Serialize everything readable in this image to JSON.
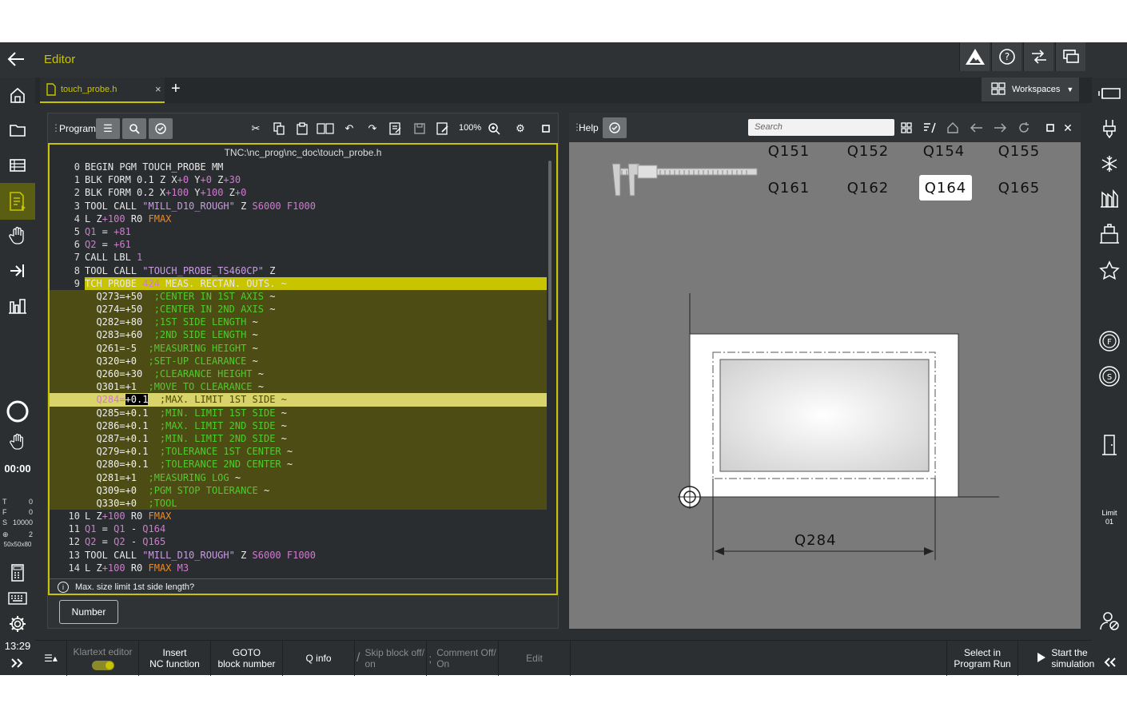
{
  "header": {
    "title": "Editor"
  },
  "tabs": {
    "file_name": "touch_probe.h",
    "close": "×",
    "add": "+",
    "workspaces_label": "Workspaces"
  },
  "sidebar": {
    "clock": "00:00",
    "time": "13:29",
    "status": [
      {
        "label": "T",
        "value": "0"
      },
      {
        "label": "F",
        "value": "0"
      },
      {
        "label": "S",
        "value": "10000"
      },
      {
        "label": "⊕",
        "value": "2"
      }
    ],
    "blank_size": "50x50x80"
  },
  "right_sidebar": {
    "limit_label": "Limit",
    "limit_value": "01"
  },
  "program": {
    "label": "Program",
    "zoom": "100%",
    "path": "TNC:\\nc_prog\\nc_doc\\touch_probe.h",
    "question": "Max. size limit 1st side length?",
    "number_button": "Number",
    "lines": [
      {
        "n": "0",
        "parts": [
          [
            "kw",
            "BEGIN PGM TOUCH_PROBE MM"
          ]
        ]
      },
      {
        "n": "1",
        "parts": [
          [
            "kw",
            "BLK FORM 0.1 Z X"
          ],
          [
            "num",
            "+0"
          ],
          [
            "kw",
            " Y"
          ],
          [
            "num",
            "+0"
          ],
          [
            "kw",
            " Z"
          ],
          [
            "num",
            "+30"
          ]
        ]
      },
      {
        "n": "2",
        "parts": [
          [
            "kw",
            "BLK FORM 0.2 X"
          ],
          [
            "num",
            "+100"
          ],
          [
            "kw",
            " Y"
          ],
          [
            "num",
            "+100"
          ],
          [
            "kw",
            " Z"
          ],
          [
            "num",
            "+0"
          ]
        ]
      },
      {
        "n": "3",
        "parts": [
          [
            "kw",
            "TOOL CALL "
          ],
          [
            "str",
            "\"MILL_D10_ROUGH\""
          ],
          [
            "kw",
            " Z "
          ],
          [
            "num",
            "S6000 F1000"
          ]
        ]
      },
      {
        "n": "4",
        "parts": [
          [
            "kw",
            "L Z"
          ],
          [
            "num",
            "+100"
          ],
          [
            "kw",
            " R0 "
          ],
          [
            "orange",
            "FMAX"
          ]
        ]
      },
      {
        "n": "5",
        "parts": [
          [
            "q",
            "Q1"
          ],
          [
            "kw",
            " = "
          ],
          [
            "num",
            "+81"
          ]
        ]
      },
      {
        "n": "6",
        "parts": [
          [
            "q",
            "Q2"
          ],
          [
            "kw",
            " = "
          ],
          [
            "num",
            "+61"
          ]
        ]
      },
      {
        "n": "7",
        "parts": [
          [
            "kw",
            "CALL LBL "
          ],
          [
            "num",
            "1"
          ]
        ]
      },
      {
        "n": "8",
        "parts": [
          [
            "kw",
            "TOOL CALL "
          ],
          [
            "str",
            "\"TOUCH_PROBE_TS460CP\""
          ],
          [
            "kw",
            " Z"
          ]
        ]
      },
      {
        "n": "9",
        "cls": "tch",
        "parts": [
          [
            "kw",
            "TCH PROBE "
          ],
          [
            "num",
            "424"
          ],
          [
            "kw",
            " MEAS. RECTAN. OUTS. ~"
          ]
        ]
      },
      {
        "n": "",
        "cls": "sub",
        "parts": [
          [
            "param",
            "  Q273=+50"
          ],
          [
            "comment",
            "  ;CENTER IN 1ST AXIS"
          ],
          [
            "param",
            " ~"
          ]
        ]
      },
      {
        "n": "",
        "cls": "sub",
        "parts": [
          [
            "param",
            "  Q274=+50"
          ],
          [
            "comment",
            "  ;CENTER IN 2ND AXIS"
          ],
          [
            "param",
            " ~"
          ]
        ]
      },
      {
        "n": "",
        "cls": "sub",
        "parts": [
          [
            "param",
            "  Q282=+80"
          ],
          [
            "comment",
            "  ;1ST SIDE LENGTH"
          ],
          [
            "param",
            " ~"
          ]
        ]
      },
      {
        "n": "",
        "cls": "sub",
        "parts": [
          [
            "param",
            "  Q283=+60"
          ],
          [
            "comment",
            "  ;2ND SIDE LENGTH"
          ],
          [
            "param",
            " ~"
          ]
        ]
      },
      {
        "n": "",
        "cls": "sub",
        "parts": [
          [
            "param",
            "  Q261=-5"
          ],
          [
            "comment",
            "  ;MEASURING HEIGHT"
          ],
          [
            "param",
            " ~"
          ]
        ]
      },
      {
        "n": "",
        "cls": "sub",
        "parts": [
          [
            "param",
            "  Q320=+0"
          ],
          [
            "comment",
            "  ;SET-UP CLEARANCE"
          ],
          [
            "param",
            " ~"
          ]
        ]
      },
      {
        "n": "",
        "cls": "sub",
        "parts": [
          [
            "param",
            "  Q260=+30"
          ],
          [
            "comment",
            "  ;CLEARANCE HEIGHT"
          ],
          [
            "param",
            " ~"
          ]
        ]
      },
      {
        "n": "",
        "cls": "sub",
        "parts": [
          [
            "param",
            "  Q301=+1"
          ],
          [
            "comment",
            "  ;MOVE TO CLEARANCE"
          ],
          [
            "param",
            " ~"
          ]
        ]
      },
      {
        "n": "",
        "cls": "cur",
        "parts": [
          [
            "curq",
            "  Q284="
          ],
          [
            "curval",
            "+0.1"
          ],
          [
            "comment",
            "  ;MAX. LIMIT 1ST SIDE"
          ],
          [
            "param",
            " ~"
          ]
        ]
      },
      {
        "n": "",
        "cls": "sub",
        "parts": [
          [
            "param",
            "  Q285=+0.1"
          ],
          [
            "comment",
            "  ;MIN. LIMIT 1ST SIDE"
          ],
          [
            "param",
            " ~"
          ]
        ]
      },
      {
        "n": "",
        "cls": "sub",
        "parts": [
          [
            "param",
            "  Q286=+0.1"
          ],
          [
            "comment",
            "  ;MAX. LIMIT 2ND SIDE"
          ],
          [
            "param",
            " ~"
          ]
        ]
      },
      {
        "n": "",
        "cls": "sub",
        "parts": [
          [
            "param",
            "  Q287=+0.1"
          ],
          [
            "comment",
            "  ;MIN. LIMIT 2ND SIDE"
          ],
          [
            "param",
            " ~"
          ]
        ]
      },
      {
        "n": "",
        "cls": "sub",
        "parts": [
          [
            "param",
            "  Q279=+0.1"
          ],
          [
            "comment",
            "  ;TOLERANCE 1ST CENTER"
          ],
          [
            "param",
            " ~"
          ]
        ]
      },
      {
        "n": "",
        "cls": "sub",
        "parts": [
          [
            "param",
            "  Q280=+0.1"
          ],
          [
            "comment",
            "  ;TOLERANCE 2ND CENTER"
          ],
          [
            "param",
            " ~"
          ]
        ]
      },
      {
        "n": "",
        "cls": "sub",
        "parts": [
          [
            "param",
            "  Q281=+1"
          ],
          [
            "comment",
            "  ;MEASURING LOG"
          ],
          [
            "param",
            " ~"
          ]
        ]
      },
      {
        "n": "",
        "cls": "sub",
        "parts": [
          [
            "param",
            "  Q309=+0"
          ],
          [
            "comment",
            "  ;PGM STOP TOLERANCE"
          ],
          [
            "param",
            " ~"
          ]
        ]
      },
      {
        "n": "",
        "cls": "sub",
        "parts": [
          [
            "param",
            "  Q330=+0"
          ],
          [
            "comment",
            "  ;TOOL"
          ]
        ]
      },
      {
        "n": "10",
        "parts": [
          [
            "kw",
            "L Z"
          ],
          [
            "num",
            "+100"
          ],
          [
            "kw",
            " R0 "
          ],
          [
            "orange",
            "FMAX"
          ]
        ]
      },
      {
        "n": "11",
        "parts": [
          [
            "q",
            "Q1"
          ],
          [
            "kw",
            " = "
          ],
          [
            "q",
            "Q1"
          ],
          [
            "kw",
            " - "
          ],
          [
            "q",
            "Q164"
          ]
        ]
      },
      {
        "n": "12",
        "parts": [
          [
            "q",
            "Q2"
          ],
          [
            "kw",
            " = "
          ],
          [
            "q",
            "Q2"
          ],
          [
            "kw",
            " - "
          ],
          [
            "q",
            "Q165"
          ]
        ]
      },
      {
        "n": "13",
        "parts": [
          [
            "kw",
            "TOOL CALL "
          ],
          [
            "str",
            "\"MILL_D10_ROUGH\""
          ],
          [
            "kw",
            " Z "
          ],
          [
            "num",
            "S6000 F1000"
          ]
        ]
      },
      {
        "n": "14",
        "parts": [
          [
            "kw",
            "L Z"
          ],
          [
            "num",
            "+100"
          ],
          [
            "kw",
            " R0 "
          ],
          [
            "orange",
            "FMAX"
          ],
          [
            "kw",
            " "
          ],
          [
            "num",
            "M3"
          ]
        ]
      }
    ]
  },
  "help": {
    "label": "Help",
    "search_placeholder": "Search",
    "q_buttons": [
      "Q151",
      "Q152",
      "Q154",
      "Q155",
      "Q161",
      "Q162",
      "Q164",
      "Q165"
    ],
    "selected": "Q164",
    "dimension_label": "Q284"
  },
  "bottom": {
    "klartext": "Klartext editor",
    "insert": "Insert\nNC function",
    "goto": "GOTO\nblock number",
    "qinfo": "Q info",
    "skip": "Skip block off/\non",
    "comment": "Comment Off/\nOn",
    "edit": "Edit",
    "select_program_run": "Select in\nProgram Run",
    "start_simulation": "Start the\nsimulation"
  },
  "colors": {
    "accent": "#c8c400",
    "tch_highlight": "#c8c400",
    "sub_highlight": "#4c4c14",
    "comment": "#4ecb2e",
    "qparam": "#d07ad0",
    "fmax": "#f08a1e"
  }
}
